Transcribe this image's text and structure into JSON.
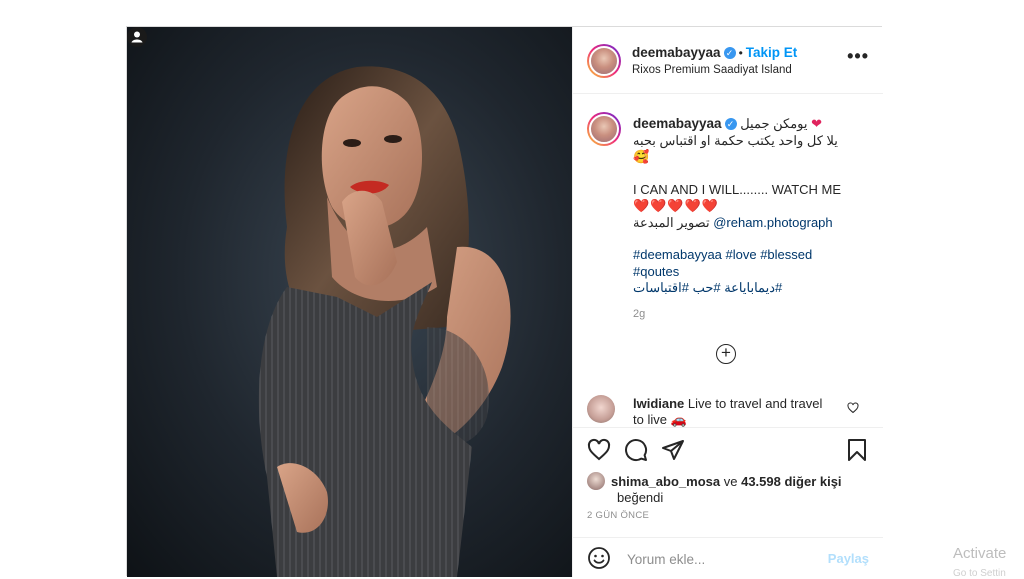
{
  "post": {
    "username": "deemabayyaa",
    "follow_label": "Takip Et",
    "location": "Rixos Premium Saadiyat Island",
    "more_label": "•••"
  },
  "caption": {
    "username": "deemabayyaa",
    "line1": "يومكن جميل",
    "line2": "يلا كل واحد يكتب حكمة او اقتباس بحبه",
    "line2_emoji": "🥰",
    "line3": "I CAN AND I WILL........ WATCH ME",
    "hearts": "❤️❤️❤️❤️❤️",
    "credit_prefix": "تصوير المبدعة",
    "credit_mention": "@reham.photograph",
    "hashtags_1": "#deemabayyaa #love #blessed",
    "hashtags_2": "#qoutes",
    "hashtags_3": "ديماباياعة #حب #اقتباسات#",
    "timestamp": "2g"
  },
  "comment": {
    "username": "lwidiane",
    "text": "Live to travel and travel to live",
    "emoji": "🚗"
  },
  "likes": {
    "first_user": "shima_abo_mosa",
    "connector": "ve",
    "others": "43.598 diğer kişi",
    "suffix": "beğendi",
    "ago": "2 GÜN ÖNCE"
  },
  "compose": {
    "placeholder": "Yorum ekle...",
    "share_label": "Paylaş"
  },
  "system": {
    "watermark": "Activate",
    "watermark_sub": "Go to Settin"
  },
  "colors": {
    "accent": "#0095f6",
    "heart": "#e0245e",
    "verified": "#3897f0"
  }
}
